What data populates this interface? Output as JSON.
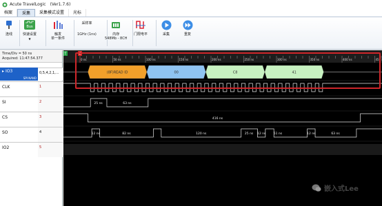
{
  "window": {
    "title": "Acute TravelLogic",
    "version": "(Ver1.7.6)"
  },
  "tabs": [
    {
      "label": "档案",
      "active": false
    },
    {
      "label": "采集",
      "active": true
    },
    {
      "label": "采集模式设置",
      "active": false
    },
    {
      "label": "光标",
      "active": false
    }
  ],
  "ribbon": {
    "connect": "连线",
    "bus_icon_text": "Bus",
    "bus_setting": "快速设置",
    "trigger": "触发",
    "trigger_sub": "单一条件",
    "sample_rate_title": "采样率",
    "sample_rate_value": "1GHz (1ns)",
    "memory_title": "内存",
    "memory_value": "548Mb - 8CH",
    "threshold": "门限电平",
    "acquire": "采集",
    "repeat": "重复"
  },
  "left_panel": {
    "timediv": "Time/Div = 50 ns",
    "acquired": "Acquired: 11:47:54.377"
  },
  "signals": [
    {
      "name": "IO3",
      "sub": "SPI NAND",
      "value": "0,5,4,2,1,...",
      "selected": true
    },
    {
      "name": "CLK",
      "value": "1"
    },
    {
      "name": "SI",
      "value": "2"
    },
    {
      "name": "CS",
      "value": "3"
    },
    {
      "name": "SO",
      "value": "4"
    },
    {
      "name": "IO2",
      "value": "5"
    }
  ],
  "ruler": {
    "labels": [
      "0 ns",
      "50 ns",
      "100 ns",
      "150 ns",
      "200 ns",
      "250 ns",
      "300 ns",
      "350 ns",
      "400 ns",
      "450 ns"
    ],
    "cursor_labels": [
      "T",
      "C"
    ]
  },
  "bus_decode": [
    {
      "label": "(8F)READ ID",
      "color": "#f2a02a",
      "start": 12,
      "end": 102
    },
    {
      "label": "00",
      "color": "#8fc4f2",
      "start": 102,
      "end": 192
    },
    {
      "label": "C8",
      "color": "#c7f2c1",
      "start": 192,
      "end": 282
    },
    {
      "label": "41",
      "color": "#c7f2c1",
      "start": 282,
      "end": 372
    }
  ],
  "measurements": {
    "si": [
      "25 ns",
      "63 ns"
    ],
    "cs": "416 ns",
    "so": [
      "12 ns",
      "82 ns",
      "120 ns",
      "25 ns",
      "12 ns",
      "51 ns",
      "12 ns",
      "63 ns"
    ]
  },
  "watermark": "嵌入式Lee",
  "colors": {
    "selected_row": "#1e62c8",
    "red_highlight": "#d0262a",
    "waveform": "#e8e8e8"
  }
}
